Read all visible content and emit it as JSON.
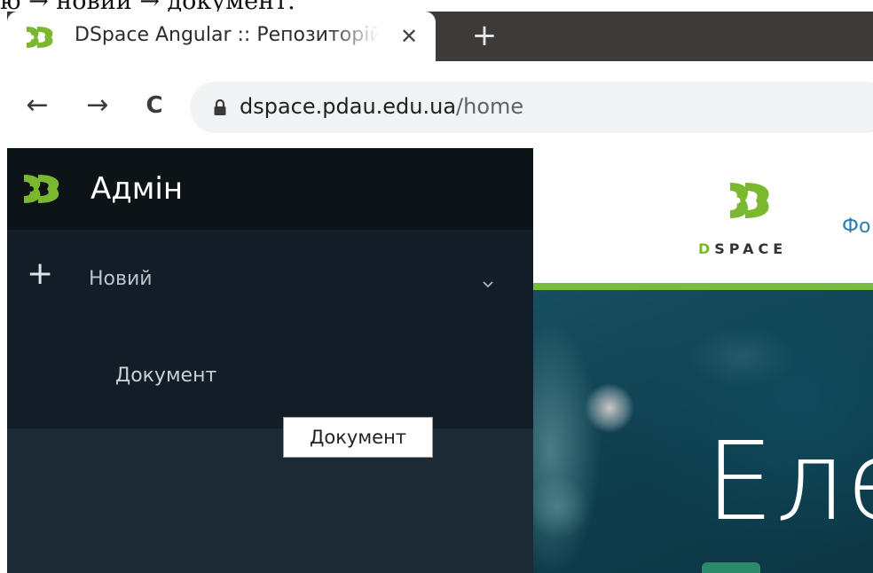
{
  "caption": {
    "text": "ю → новий → документ."
  },
  "browser": {
    "tab": {
      "title": "DSpace Angular :: Репозиторій",
      "favicon": "dspace-favicon-icon",
      "close_glyph": "✕"
    },
    "new_tab_glyph": "+",
    "nav": {
      "back_glyph": "←",
      "forward_glyph": "→",
      "reload_glyph": "C"
    },
    "url": {
      "host": "dspace.pdau.edu.ua",
      "path": "/home"
    }
  },
  "sidebar": {
    "title": "Адмін",
    "new_section": {
      "label": "Новий",
      "plus_glyph": "+",
      "items": [
        {
          "label": "Документ"
        }
      ]
    },
    "tooltip": "Документ"
  },
  "site": {
    "logo_word_first": "D",
    "logo_word_rest": "SPACE",
    "nav_link": "Фо",
    "hero_title": "Еле"
  },
  "colors": {
    "sidebar_bg": "#1c2a36",
    "sidebar_header_bg": "#0d1418",
    "brand_green": "#78be3c",
    "link_blue": "#2b7db5"
  }
}
